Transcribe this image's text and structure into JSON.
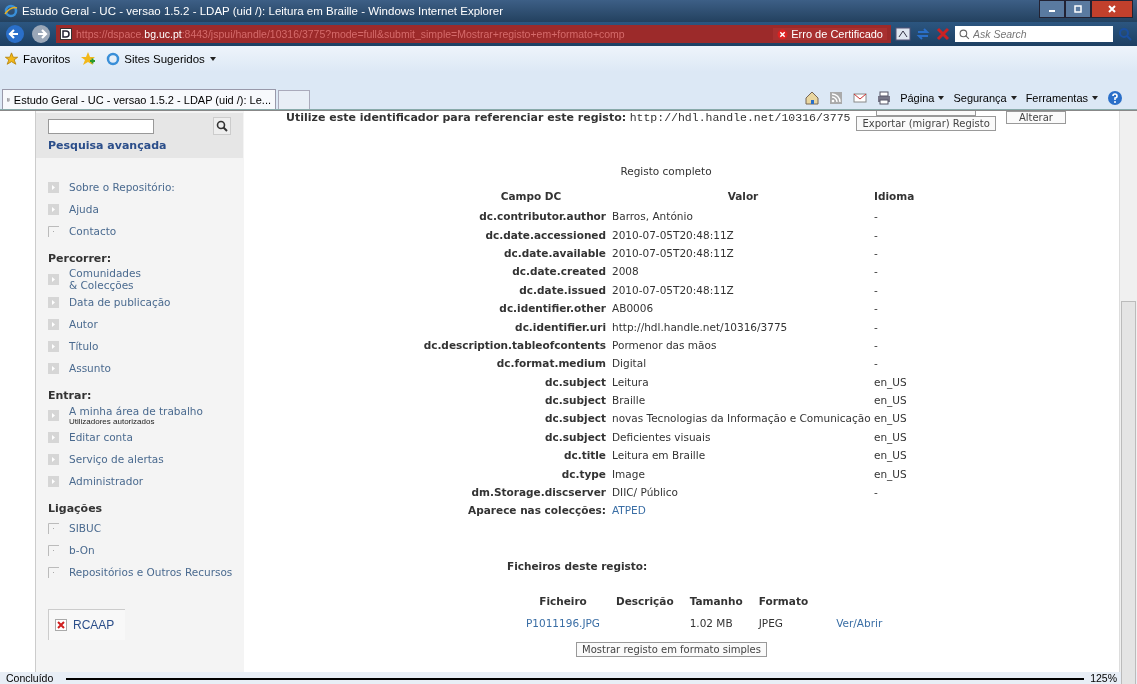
{
  "window": {
    "title": "Estudo Geral - UC - versao 1.5.2 - LDAP (uid /): Leitura em Braille - Windows Internet Explorer"
  },
  "address_bar": {
    "url_prefix": "https://dspace.",
    "url_host": "bg.uc.pt",
    "url_rest": ":8443/jspui/handle/10316/3775?mode=full&submit_simple=Mostrar+registo+em+formato+comp",
    "certificate_error": "Erro de Certificado",
    "search_placeholder": "Ask Search"
  },
  "favorites_bar": {
    "favorites": "Favoritos",
    "suggested": "Sites Sugeridos"
  },
  "tab": {
    "title": "Estudo Geral - UC - versao 1.5.2 - LDAP (uid /): Le...",
    "selected": true
  },
  "command_bar": [
    "Página",
    "Segurança",
    "Ferramentas"
  ],
  "sidebar": {
    "advanced_search": "Pesquisa avançada",
    "sections": [
      {
        "items": [
          {
            "label": "Sobre o Repositório:",
            "kind": "arrow"
          },
          {
            "label": "Ajuda",
            "kind": "arrow"
          },
          {
            "label": "Contacto",
            "kind": "link"
          }
        ]
      },
      {
        "heading": "Percorrer:",
        "items": [
          {
            "label": "Comunidades\n& Colecções",
            "kind": "arrow"
          },
          {
            "label": "Data de publicação",
            "kind": "arrow"
          },
          {
            "label": "Autor",
            "kind": "arrow"
          },
          {
            "label": "Título",
            "kind": "arrow"
          },
          {
            "label": "Assunto",
            "kind": "arrow"
          }
        ]
      },
      {
        "heading": "Entrar:",
        "items": [
          {
            "label": "A minha área de trabalho",
            "note": "Utilizadores autorizados",
            "kind": "arrow"
          },
          {
            "label": "Editar conta",
            "kind": "arrow"
          },
          {
            "label": "Serviço de alertas",
            "kind": "arrow"
          },
          {
            "label": "Administrador",
            "kind": "arrow"
          }
        ]
      },
      {
        "heading": "Ligações",
        "items": [
          {
            "label": "SIBUC",
            "kind": "link"
          },
          {
            "label": "b-On",
            "kind": "link"
          },
          {
            "label": "Repositórios e Outros Recursos",
            "kind": "link"
          }
        ]
      }
    ],
    "badge": "RCAAP"
  },
  "identifier": {
    "label": "Utilize este identificador para referenciar este registo:",
    "url": "http://hdl.handle.net/10316/3775"
  },
  "buttons": {
    "export": "Exportar (migrar) Registo",
    "edit": "Alterar"
  },
  "record": {
    "title": "Registo completo",
    "columns": [
      "Campo DC",
      "Valor",
      "Idioma"
    ],
    "rows": [
      {
        "field": "dc.contributor.author",
        "value": "Barros, António",
        "lang": "-"
      },
      {
        "field": "dc.date.accessioned",
        "value": "2010-07-05T20:48:11Z",
        "lang": "-"
      },
      {
        "field": "dc.date.available",
        "value": "2010-07-05T20:48:11Z",
        "lang": "-"
      },
      {
        "field": "dc.date.created",
        "value": "2008",
        "lang": "-"
      },
      {
        "field": "dc.date.issued",
        "value": "2010-07-05T20:48:11Z",
        "lang": "-"
      },
      {
        "field": "dc.identifier.other",
        "value": "AB0006",
        "lang": "-"
      },
      {
        "field": "dc.identifier.uri",
        "value": "http://hdl.handle.net/10316/3775",
        "lang": "-"
      },
      {
        "field": "dc.description.tableofcontents",
        "value": "Pormenor das mãos",
        "lang": "-"
      },
      {
        "field": "dc.format.medium",
        "value": "Digital",
        "lang": "-"
      },
      {
        "field": "dc.subject",
        "value": "Leitura",
        "lang": "en_US"
      },
      {
        "field": "dc.subject",
        "value": "Braille",
        "lang": "en_US"
      },
      {
        "field": "dc.subject",
        "value": "novas Tecnologias da Informação e Comunicação",
        "lang": "en_US"
      },
      {
        "field": "dc.subject",
        "value": "Deficientes visuais",
        "lang": "en_US"
      },
      {
        "field": "dc.title",
        "value": "Leitura em Braille",
        "lang": "en_US"
      },
      {
        "field": "dc.type",
        "value": "Image",
        "lang": "en_US"
      },
      {
        "field": "dm.Storage.discserver",
        "value": "DIIC/ Público",
        "lang": "-"
      }
    ],
    "collections_label": "Aparece nas colecções:",
    "collection": "ATPED"
  },
  "files": {
    "title": "Ficheiros deste registo:",
    "columns": [
      "Ficheiro",
      "Descrição",
      "Tamanho",
      "Formato"
    ],
    "rows": [
      {
        "name": "P1011196.JPG",
        "size": "1.02 MB",
        "format": "JPEG",
        "open": "Ver/Abrir"
      }
    ],
    "simple_button": "Mostrar registo em formato simples"
  },
  "status_bar": {
    "text": "Concluído",
    "zoom": "125%"
  }
}
